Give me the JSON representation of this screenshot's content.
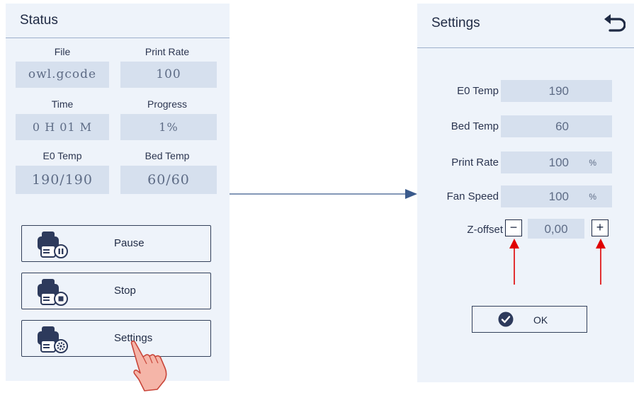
{
  "status": {
    "title": "Status",
    "fields": [
      {
        "label": "File",
        "value": "owl.gcode"
      },
      {
        "label": "Print Rate",
        "value": "100"
      },
      {
        "label": "Time",
        "value": "0 H 01 M"
      },
      {
        "label": "Progress",
        "value": "1%"
      },
      {
        "label": "E0 Temp",
        "value": "190/190"
      },
      {
        "label": "Bed Temp",
        "value": "60/60"
      }
    ],
    "buttons": [
      {
        "label": "Pause",
        "icon": "printer-pause-icon"
      },
      {
        "label": "Stop",
        "icon": "printer-stop-icon"
      },
      {
        "label": "Settings",
        "icon": "printer-settings-icon"
      }
    ]
  },
  "settings": {
    "title": "Settings",
    "back_icon": "back-arrow-icon",
    "rows": [
      {
        "label": "E0 Temp",
        "value": "190",
        "unit": ""
      },
      {
        "label": "Bed Temp",
        "value": "60",
        "unit": ""
      },
      {
        "label": "Print Rate",
        "value": "100",
        "unit": "%"
      },
      {
        "label": "Fan Speed",
        "value": "100",
        "unit": "%"
      }
    ],
    "zoffset": {
      "label": "Z-offset",
      "value": "0,00",
      "minus": "−",
      "plus": "+"
    },
    "ok_label": "OK"
  },
  "colors": {
    "panel_bg": "#eef3fa",
    "field_bg": "#d6e0ee",
    "accent": "#2d3a5c",
    "arrow_red": "#e00000",
    "flow_arrow": "#3a5a8c"
  }
}
